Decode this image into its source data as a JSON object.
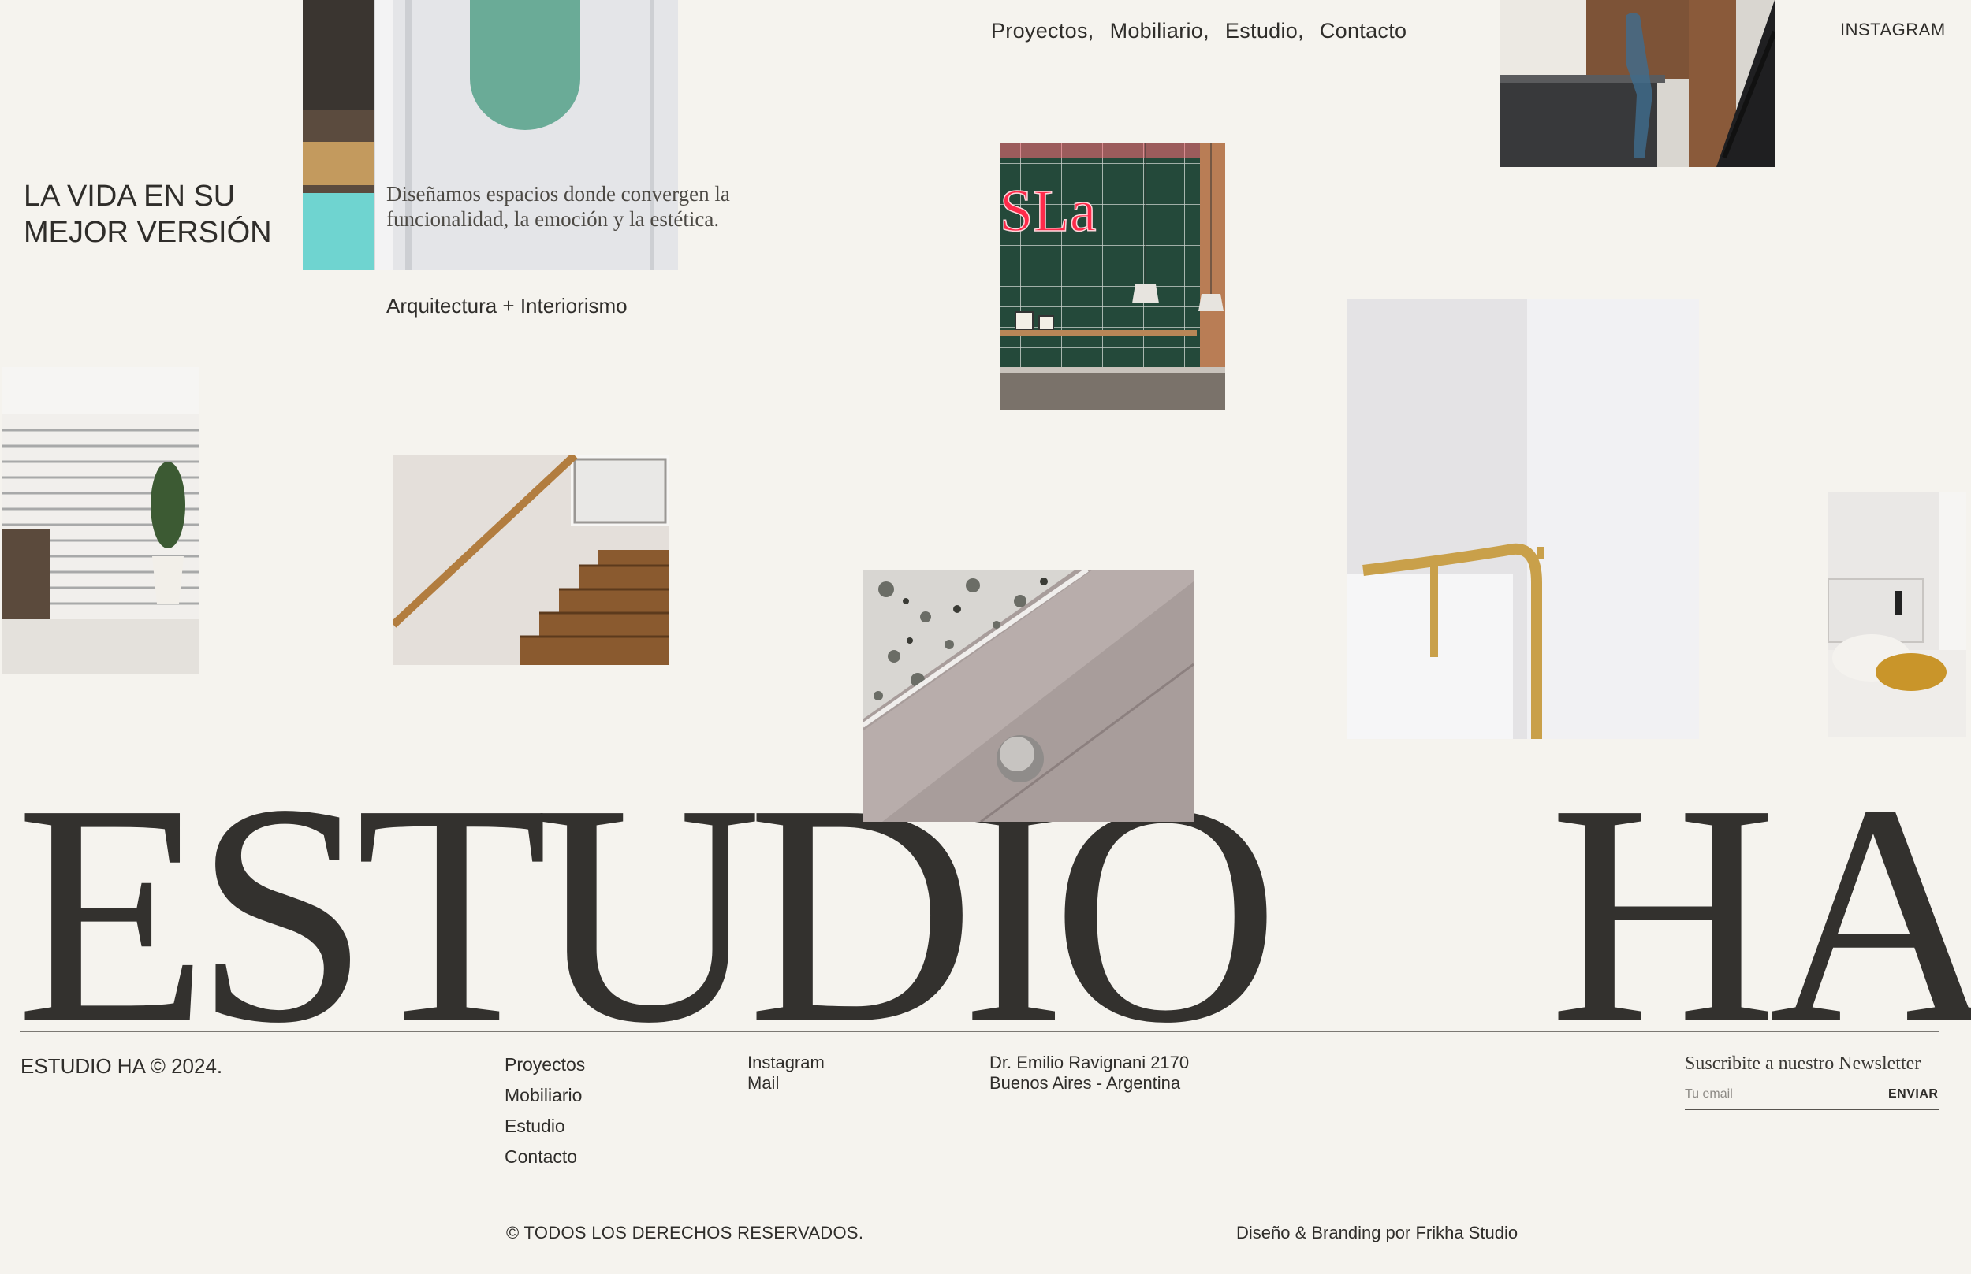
{
  "nav": {
    "items": [
      {
        "label": "Proyectos,"
      },
      {
        "label": "Mobiliario,"
      },
      {
        "label": "Estudio,"
      },
      {
        "label": "Contacto"
      }
    ],
    "instagram": "INSTAGRAM"
  },
  "hero": {
    "tagline_line1": "LA VIDA EN SU",
    "tagline_line2": "MEJOR VERSIÓN",
    "mission": "Diseñamos espacios donde convergen la funcionalidad, la emoción y la estética.",
    "subtitle": "Arquitectura + Interiorismo",
    "wordmark_left": "ESTUDIO",
    "wordmark_right": "HA",
    "neon_text": "SLa"
  },
  "footer": {
    "copyright": "ESTUDIO HA © 2024.",
    "links": [
      "Proyectos",
      "Mobiliario",
      "Estudio",
      "Contacto"
    ],
    "social": [
      "Instagram",
      "Mail"
    ],
    "address_line1": "Dr. Emilio Ravignani 2170",
    "address_line2": "Buenos Aires - Argentina",
    "newsletter_title": "Suscribite a nuestro Newsletter",
    "newsletter_placeholder": "Tu email",
    "newsletter_button": "ENVIAR",
    "rights": "© TODOS LOS DERECHOS RESERVADOS.",
    "credit": "Diseño & Branding por Frikha Studio"
  },
  "colors": {
    "background": "#f5f3ee",
    "text": "#2f2d2a",
    "tile_green": "#24493a",
    "neon_red": "#ff2a4a",
    "brass": "#c9a04a"
  }
}
